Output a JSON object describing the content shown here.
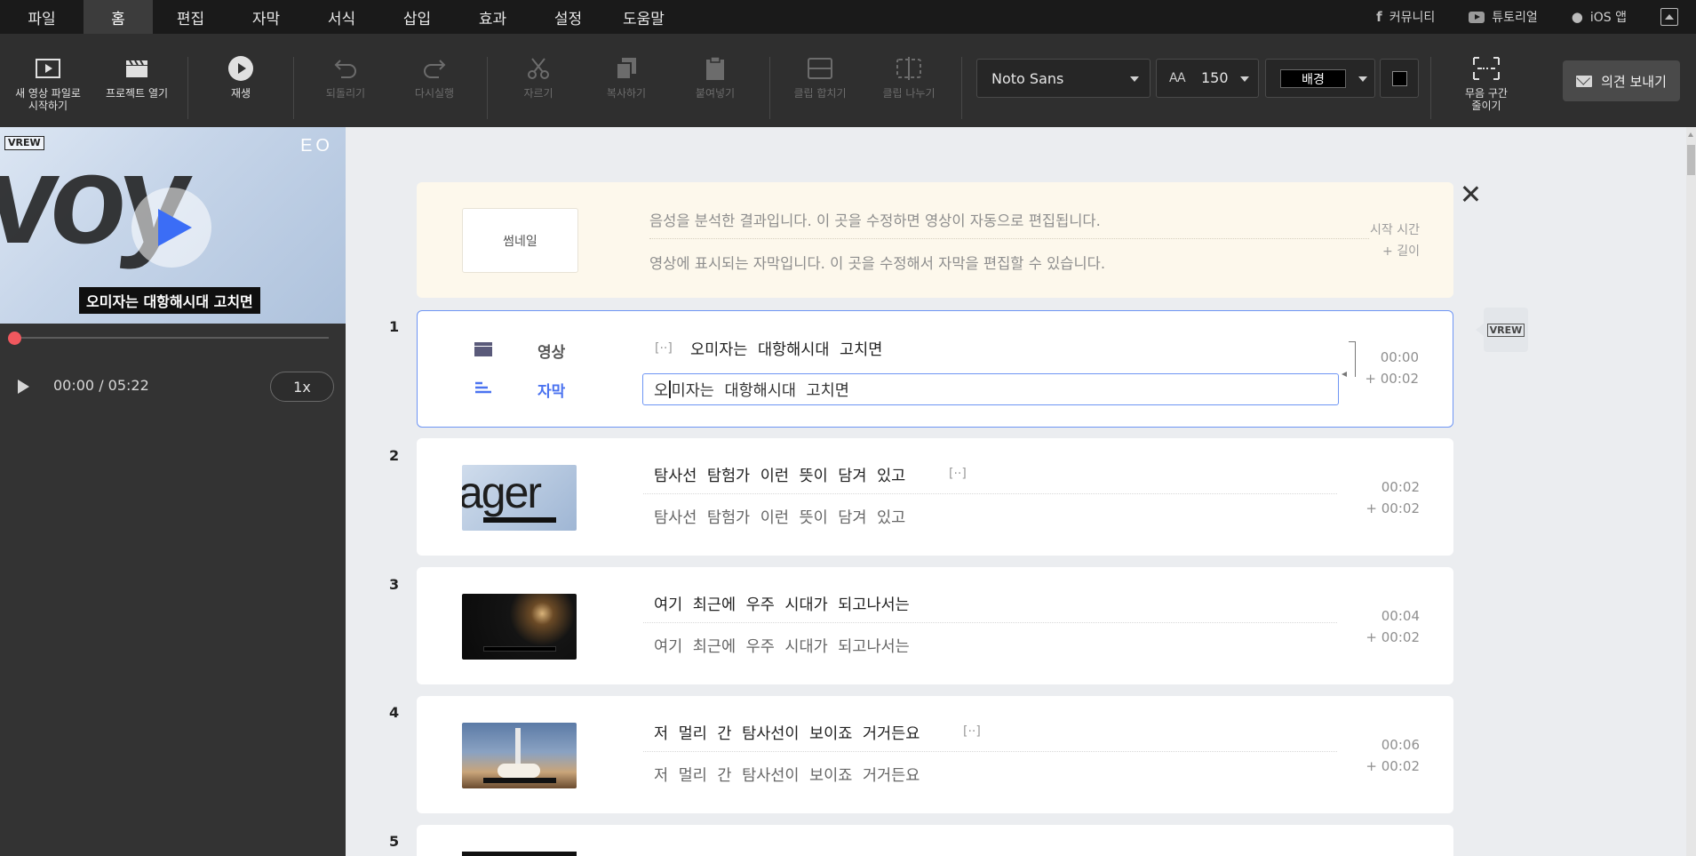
{
  "menu": {
    "items": [
      "파일",
      "홈",
      "편집",
      "자막",
      "서식",
      "삽입",
      "효과",
      "설정",
      "도움말"
    ],
    "active_index": 1,
    "links": [
      {
        "label": "커뮤니티",
        "icon": "facebook-icon"
      },
      {
        "label": "튜토리얼",
        "icon": "youtube-icon"
      },
      {
        "label": "iOS 앱",
        "icon": "apple-icon"
      }
    ]
  },
  "toolbar": {
    "new_video": "새 영상 파일로\n시작하기",
    "open_project": "프로젝트 열기",
    "play": "재생",
    "undo": "되돌리기",
    "redo": "다시실행",
    "cut": "자르기",
    "copy": "복사하기",
    "paste": "붙여넣기",
    "merge": "클립 합치기",
    "split": "클립 나누기",
    "font_name": "Noto Sans",
    "font_size": "150",
    "background": "배경",
    "color_hex": "#000000",
    "shrink_silence": "무음 구간\n줄이기",
    "feedback": "의견 보내기"
  },
  "player": {
    "logo": "VREW",
    "channel_logo": "EO",
    "overlay_text": "voy",
    "subtitle": "오미자는 대항해시대 고치면",
    "time": "00:00 / 05:22",
    "progress": 0.0,
    "speed": "1x"
  },
  "help": {
    "thumbnail_label": "썸네일",
    "line1": "음성을 분석한 결과입니다. 이 곳을 수정하면 영상이 자동으로 편집됩니다.",
    "line2": "영상에 표시되는 자막입니다. 이 곳을 수정해서 자막을 편집할 수 있습니다.",
    "meta1": "시작 시간",
    "meta2": "+ 길이"
  },
  "clips": [
    {
      "num": "1",
      "video_label": "영상",
      "sub_label": "자막",
      "gap_mark": "[··]",
      "speech": "오미자는 대항해시대 고치면",
      "sub_first": "오",
      "sub_rest": "미자는 대항해시대 고치면",
      "start": "00:00",
      "length": "+ 00:02"
    },
    {
      "num": "2",
      "speech": "탐사선 탐험가 이런 뜻이 담겨 있고",
      "gap_mark": "[··]",
      "subtitle": "탐사선 탐험가 이런 뜻이 담겨 있고",
      "start": "00:02",
      "length": "+ 00:02",
      "thumb_text": "ager"
    },
    {
      "num": "3",
      "speech": "여기 최근에 우주 시대가 되고나서는",
      "subtitle": "여기 최근에 우주 시대가 되고나서는",
      "start": "00:04",
      "length": "+ 00:02"
    },
    {
      "num": "4",
      "speech": "저 멀리 간 탐사선이 보이죠 거거든요",
      "gap_mark": "[··]",
      "subtitle": "저 멀리 간 탐사선이 보이죠 거거든요",
      "start": "00:06",
      "length": "+ 00:02"
    },
    {
      "num": "5"
    }
  ],
  "side_tag": "VREW"
}
